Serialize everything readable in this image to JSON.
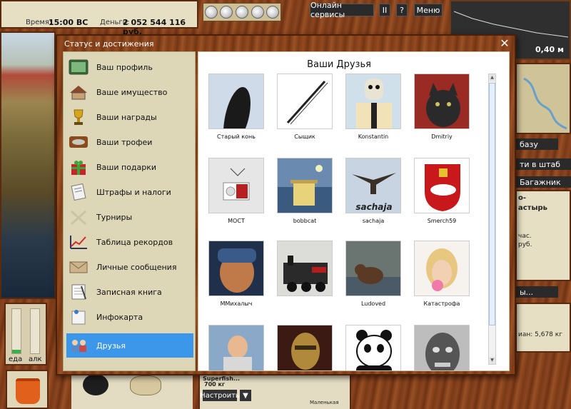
{
  "topbar": {
    "time_label": "Время:",
    "time_value": "15:00 ВС",
    "money_label": "Деньги:",
    "money_value": "2 052 544 116 руб.",
    "online_services": "Онлайн сервисы",
    "pause": "II",
    "help": "?",
    "menu": "Меню",
    "depth_value": "0,40 м"
  },
  "meters": {
    "food_label": "еда",
    "alc_label": "алк",
    "food_level": 0.08,
    "alc_level": 0.0
  },
  "right_panels": {
    "base": "базу",
    "to_hq": "ти в штаб",
    "trunk": "Багажник",
    "monastery_1": "о-",
    "monastery_2": "астырь",
    "hours": "час.",
    "rub": "руб.",
    "more": "ы...",
    "weight": "иан: 5,678 кг"
  },
  "bottom": {
    "gear_name": "Superfish...",
    "gear_weight": "700 кг",
    "tune": "Настроить",
    "small": "Маленькая"
  },
  "modal": {
    "title": "Статус и достижения",
    "close": "✕",
    "menu": [
      {
        "label": "Ваш профиль",
        "icon": "profile-icon"
      },
      {
        "label": "Ваше имущество",
        "icon": "property-icon"
      },
      {
        "label": "Ваши награды",
        "icon": "trophy-icon"
      },
      {
        "label": "Ваши трофеи",
        "icon": "fish-trophy-icon"
      },
      {
        "label": "Ваши подарки",
        "icon": "gift-icon"
      },
      {
        "label": "Штрафы и налоги",
        "icon": "fines-icon"
      },
      {
        "label": "Турниры",
        "icon": "tournament-icon"
      },
      {
        "label": "Таблица рекордов",
        "icon": "records-chart-icon"
      },
      {
        "label": "Личные сообщения",
        "icon": "envelope-icon"
      },
      {
        "label": "Записная книга",
        "icon": "notebook-icon"
      },
      {
        "label": "Инфокарта",
        "icon": "infocard-icon"
      },
      {
        "label": "Друзья",
        "icon": "friends-icon",
        "active": true
      }
    ],
    "friends_title": "Ваши Друзья",
    "friends": [
      {
        "name": "Старый конь"
      },
      {
        "name": "Сыщик"
      },
      {
        "name": "Konstantin"
      },
      {
        "name": "Dmitriy"
      },
      {
        "name": "MOCT"
      },
      {
        "name": "bobbcat"
      },
      {
        "name": "sachaja"
      },
      {
        "name": "Smerch59"
      },
      {
        "name": "MMихалыч"
      },
      {
        "name": "Ludoved"
      },
      {
        "name": "Катастрофа"
      },
      {
        "name": ""
      },
      {
        "name": ""
      },
      {
        "name": ""
      },
      {
        "name": ""
      },
      {
        "name": ""
      }
    ],
    "sachaja_text": "sachaja"
  }
}
